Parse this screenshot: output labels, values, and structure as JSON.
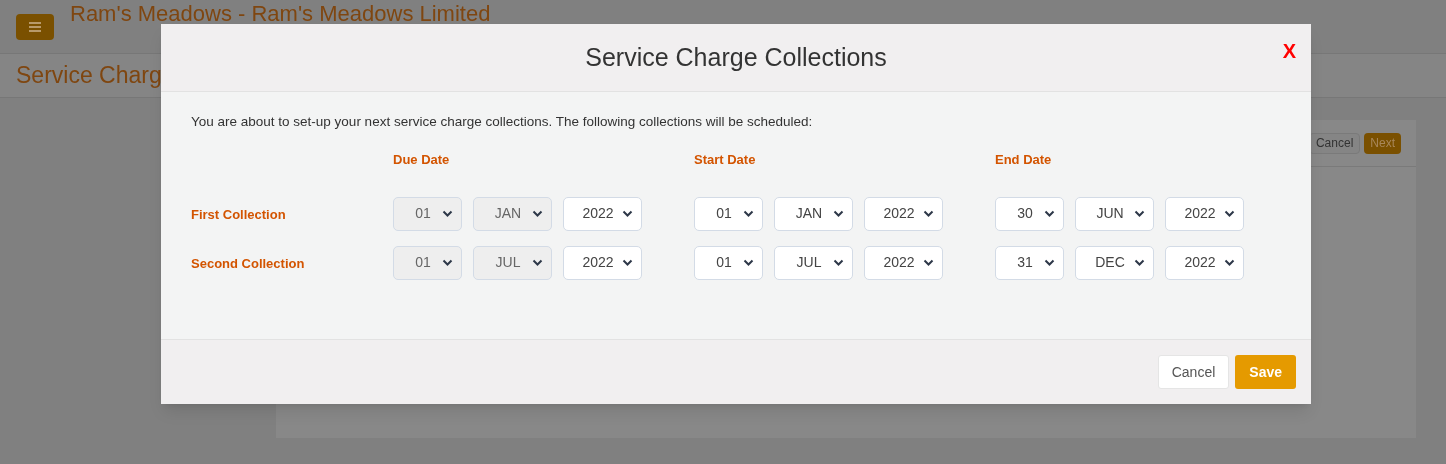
{
  "page": {
    "title": "Ram's Meadows - Ram's Meadows Limited",
    "section_title": "Service Charg",
    "toolbar_buttons": [
      {
        "label": "Cancel",
        "kind": "secondary"
      },
      {
        "label": "Next",
        "kind": "primary"
      }
    ]
  },
  "modal": {
    "title": "Service Charge Collections",
    "close": "X",
    "intro": "You are about to set-up your next service charge collections. The following collections will be scheduled:",
    "columns": [
      "Due Date",
      "Start Date",
      "End Date"
    ],
    "rows": [
      {
        "label": "First Collection",
        "dates": [
          [
            {
              "value": "01",
              "disabled": true
            },
            {
              "value": "JAN",
              "disabled": true
            },
            {
              "value": "2022",
              "disabled": false
            }
          ],
          [
            {
              "value": "01",
              "disabled": false
            },
            {
              "value": "JAN",
              "disabled": false
            },
            {
              "value": "2022",
              "disabled": false
            }
          ],
          [
            {
              "value": "30",
              "disabled": false
            },
            {
              "value": "JUN",
              "disabled": false
            },
            {
              "value": "2022",
              "disabled": false
            }
          ]
        ]
      },
      {
        "label": "Second Collection",
        "dates": [
          [
            {
              "value": "01",
              "disabled": true
            },
            {
              "value": "JUL",
              "disabled": true
            },
            {
              "value": "2022",
              "disabled": false
            }
          ],
          [
            {
              "value": "01",
              "disabled": false
            },
            {
              "value": "JUL",
              "disabled": false
            },
            {
              "value": "2022",
              "disabled": false
            }
          ],
          [
            {
              "value": "31",
              "disabled": false
            },
            {
              "value": "DEC",
              "disabled": false
            },
            {
              "value": "2022",
              "disabled": false
            }
          ]
        ]
      }
    ],
    "buttons": [
      {
        "label": "Cancel",
        "kind": "secondary"
      },
      {
        "label": "Save",
        "kind": "primary"
      }
    ]
  }
}
